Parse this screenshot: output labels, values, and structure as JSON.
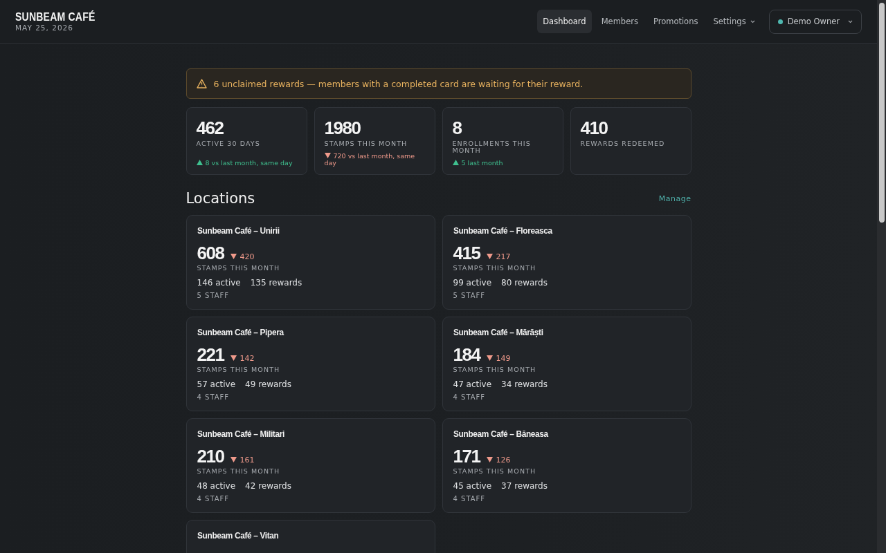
{
  "header": {
    "brand": "SUNBEAM CAFÉ",
    "date": "MAY 25, 2026"
  },
  "nav": [
    {
      "label": "Dashboard",
      "selected": true,
      "kind": "link"
    },
    {
      "label": "Members",
      "selected": false,
      "kind": "link"
    },
    {
      "label": "Promotions",
      "selected": false,
      "kind": "link"
    },
    {
      "label": "Settings",
      "selected": false,
      "kind": "menu"
    }
  ],
  "account": {
    "label": "Demo Owner",
    "color": "#4fb8b0"
  },
  "alert": {
    "text": "6 unclaimed rewards — members with a completed card are waiting for their reward."
  },
  "stats": [
    {
      "value": "462",
      "label": "ACTIVE 30 DAYS",
      "delta": {
        "up": true,
        "text": "8 vs last month, same day"
      }
    },
    {
      "value": "1980",
      "label": "STAMPS THIS MONTH",
      "delta": {
        "up": false,
        "text": "720 vs last month, same day"
      }
    },
    {
      "value": "8",
      "label": "ENROLLMENTS THIS MONTH",
      "delta": {
        "up": true,
        "text": "5 last month"
      }
    },
    {
      "value": "410",
      "label": "REWARDS REDEEMED"
    }
  ],
  "locations": {
    "title": "Locations",
    "action": "Manage",
    "items": [
      {
        "name": "Sunbeam Café – Unirii",
        "stamps": "608",
        "delta": {
          "up": false,
          "text": "420"
        },
        "label": "STAMPS THIS MONTH",
        "active": "146 active",
        "rewards": "135 rewards",
        "staff": "5 STAFF"
      },
      {
        "name": "Sunbeam Café – Floreasca",
        "stamps": "415",
        "delta": {
          "up": false,
          "text": "217"
        },
        "label": "STAMPS THIS MONTH",
        "active": "99 active",
        "rewards": "80 rewards",
        "staff": "5 STAFF"
      },
      {
        "name": "Sunbeam Café – Pipera",
        "stamps": "221",
        "delta": {
          "up": false,
          "text": "142"
        },
        "label": "STAMPS THIS MONTH",
        "active": "57 active",
        "rewards": "49 rewards",
        "staff": "4 STAFF"
      },
      {
        "name": "Sunbeam Café – Mărăști",
        "stamps": "184",
        "delta": {
          "up": false,
          "text": "149"
        },
        "label": "STAMPS THIS MONTH",
        "active": "47 active",
        "rewards": "34 rewards",
        "staff": "4 STAFF"
      },
      {
        "name": "Sunbeam Café – Militari",
        "stamps": "210",
        "delta": {
          "up": false,
          "text": "161"
        },
        "label": "STAMPS THIS MONTH",
        "active": "48 active",
        "rewards": "42 rewards",
        "staff": "4 STAFF"
      },
      {
        "name": "Sunbeam Café – Băneasa",
        "stamps": "171",
        "delta": {
          "up": false,
          "text": "126"
        },
        "label": "STAMPS THIS MONTH",
        "active": "45 active",
        "rewards": "37 rewards",
        "staff": "4 STAFF"
      },
      {
        "name": "Sunbeam Café – Vitan"
      }
    ]
  }
}
